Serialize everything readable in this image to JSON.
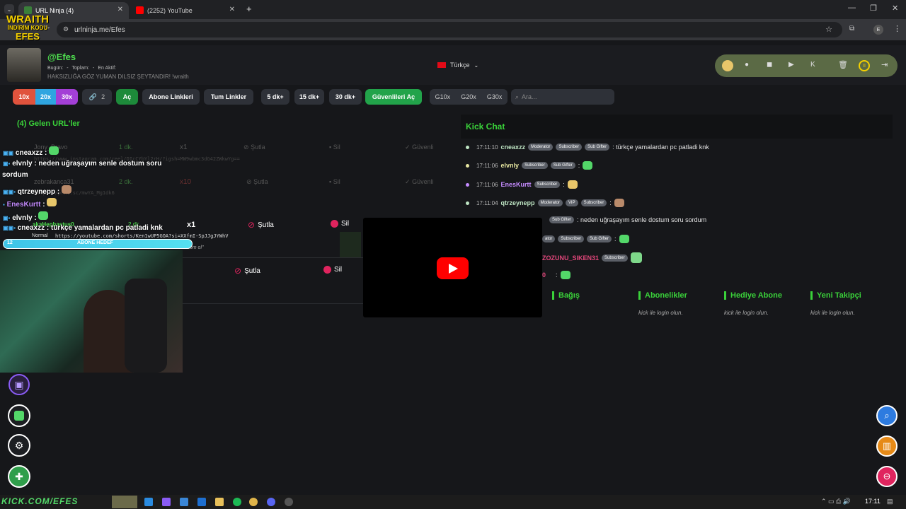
{
  "browser": {
    "tabs": [
      {
        "title": "URL Ninja (4)",
        "active": true
      },
      {
        "title": "(2252) YouTube",
        "active": false
      }
    ],
    "url": "urlninja.me/Efes",
    "new_tab": "+",
    "minimize": "—",
    "restore": "❐",
    "close": "✕"
  },
  "overlay": {
    "brand_top": "WRAITH",
    "brand_mid": "İNDİRİM KODU",
    "brand_bottom": "EFES",
    "abone_hedef": "ABONE HEDEF",
    "abone_num": "12",
    "taskbar_brand": "KICK.COM/EFES",
    "chat": [
      {
        "user": "cneaxzz",
        "text": ""
      },
      {
        "user": "elvnly",
        "text": ": neden uğraşayım senle dostum soru"
      },
      {
        "user": "",
        "text": "sordum"
      },
      {
        "user": "qtrzeynepp",
        "text": ":"
      },
      {
        "user": "EnesKurtt",
        "text": ":"
      },
      {
        "user": "elvnly",
        "text": ":"
      },
      {
        "user": "cneaxzz",
        "text": ": türkçe yamalardan pc patladi knk"
      }
    ]
  },
  "profile": {
    "handle": "@Efes",
    "stats": [
      "Bugün:",
      "-",
      "Toplam:",
      "-",
      "En Aktif:"
    ],
    "bio": "HAKSIZLIĞA GÖZ YUMAN DILSIZ ŞEYTANDIR! !wraith",
    "language": "Türkçe"
  },
  "toolbar": {
    "mult": [
      "10x",
      "20x",
      "30x"
    ],
    "link_count": "2",
    "open": "Aç",
    "sub_links": "Abone Linkleri",
    "all_links": "Tum Linkler",
    "t5": "5 dk+",
    "t15": "15 dk+",
    "t30": "30 dk+",
    "safe_open": "Güvenlileri Aç",
    "g10": "G10x",
    "g20": "G20x",
    "g30": "G30x",
    "search_placeholder": "Ara..."
  },
  "incoming": {
    "title": "(4) Gelen URL'ler",
    "rows": [
      {
        "user": "Jony_Bravo",
        "time": "1 dk.",
        "mult": "x1",
        "skip": "Şutla",
        "del": "Sil",
        "safe": "Güvenli",
        "url": "https://www.instagram.com/reel/DIcCYbYl2rH/?igsh=MW9wbmc3dG42ZWkwYg=="
      },
      {
        "user": "zebrakanca31",
        "time": "2 dk.",
        "mult": "x10",
        "skip": "Şutla",
        "del": "Sil",
        "safe": "Güvenli",
        "url": "https://prnt.sc/mwYA_Mg1dk6"
      },
      {
        "user": "akaHepbastus0",
        "time": "2 dk.",
        "mult": "x1",
        "skip": "Şutla",
        "del": "Sil",
        "url": "https://youtube.com/shorts/Ken1wUP5GOA?si=XXfmI-SpJJgJYWhV",
        "tag": "Normal"
      },
      {
        "user": "",
        "time": "",
        "mult": "",
        "skip": "Şutla",
        "del": "Sil",
        "url": ""
      }
    ],
    "note": "oom ol\""
  },
  "kick_chat": {
    "title": "Kick Chat",
    "messages": [
      {
        "time": "17:11:10",
        "user": "cneaxzz",
        "badges": [
          "Moderator",
          "Subscriber",
          "Sub Gifter"
        ],
        "text": ": türkçe yamalardan pc patladi knk",
        "color": "#bfe6c4"
      },
      {
        "time": "17:11:06",
        "user": "elvnly",
        "badges": [
          "Subscriber",
          "Sub Gifter"
        ],
        "text": ":",
        "color": "#e6e6a0"
      },
      {
        "time": "17:11:06",
        "user": "EnesKurtt",
        "badges": [
          "Subscriber"
        ],
        "text": ":",
        "color": "#c58bff"
      },
      {
        "time": "17:11:04",
        "user": "qtrzeynepp",
        "badges": [
          "Moderator",
          "VIP",
          "Subscriber"
        ],
        "text": ":",
        "color": "#bfe6c4"
      },
      {
        "time": "",
        "user": "",
        "badges": [
          "Sub Gifter"
        ],
        "text": ": neden uğraşayım senle dostum soru sordum",
        "color": "#e6e6e6"
      },
      {
        "time": "",
        "user": "",
        "badges": [
          "ator",
          "Subscriber",
          "Sub Gifter"
        ],
        "text": ":",
        "color": "#e6e6e6"
      },
      {
        "time": "",
        "user": "ZOZUNU_SIKEN31",
        "badges": [
          "Subscriber"
        ],
        "text": "",
        "color": "#e0467a"
      },
      {
        "time": "",
        "user": "0",
        "badges": [],
        "text": ":",
        "color": "#e0467a"
      }
    ]
  },
  "panels": [
    {
      "title": "Bağış",
      "sub": ""
    },
    {
      "title": "Abonelikler",
      "sub": "kick ile login olun."
    },
    {
      "title": "Hediye Abone",
      "sub": "kick ile login olun."
    },
    {
      "title": "Yeni Takipçi",
      "sub": "kick ile login olun."
    }
  ],
  "taskbar": {
    "time": "17:11"
  },
  "colors": {
    "accent_green": "#3ad23a",
    "kick_green": "#53fc18",
    "danger": "#e0245e",
    "youtube_red": "#ff0000"
  }
}
